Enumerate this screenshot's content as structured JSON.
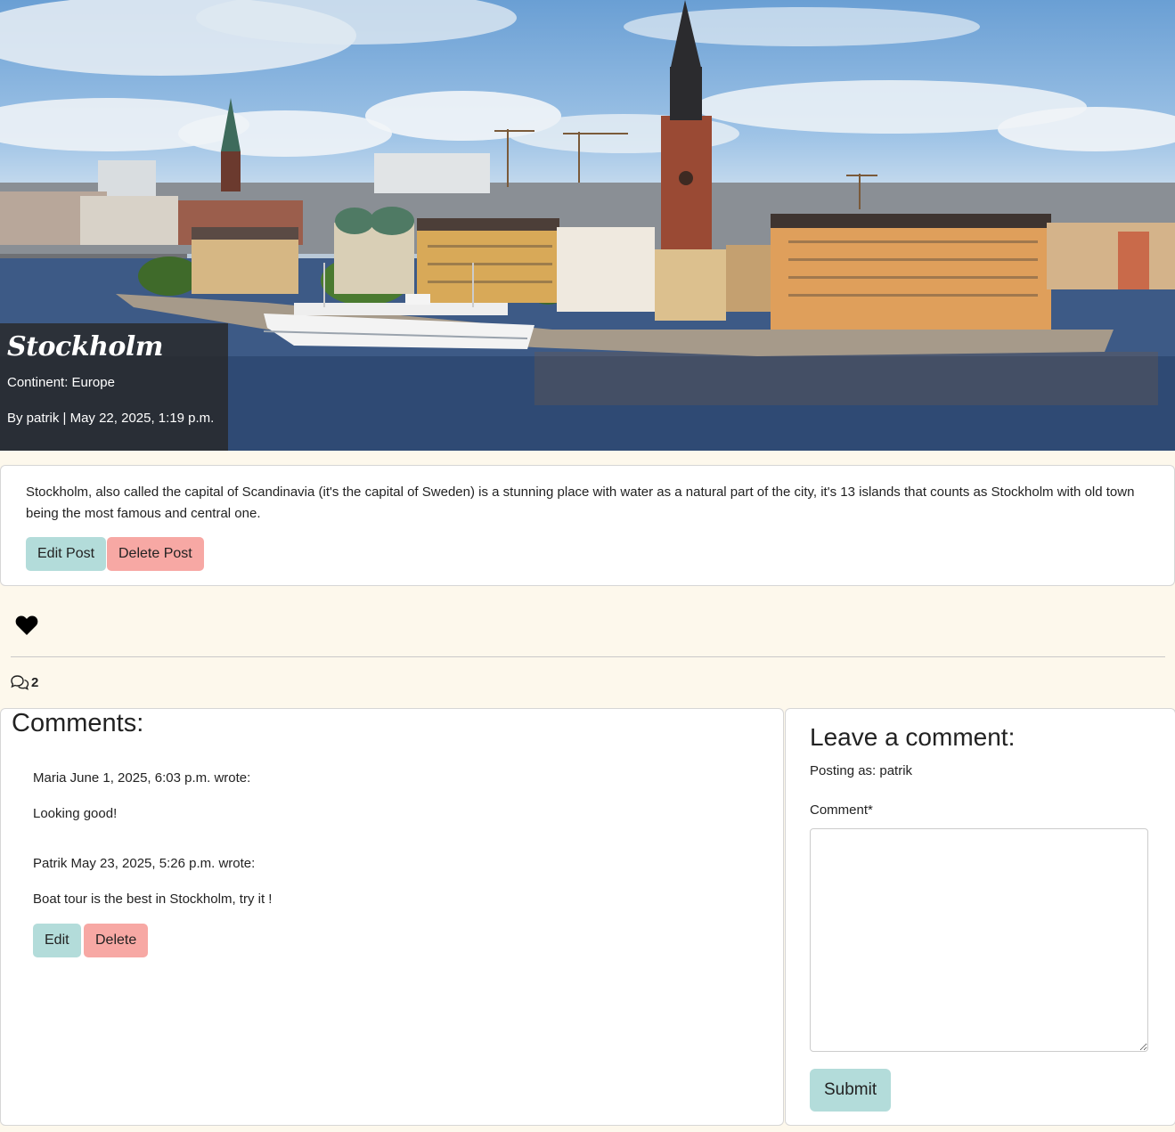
{
  "post": {
    "title": "Stockholm",
    "continent": "Continent: Europe",
    "byline": "By patrik | May 22, 2025, 1:19 p.m.",
    "body": "Stockholm, also called the capital of Scandinavia (it's the capital of Sweden) is a stunning place with water as a natural part of the city, it's 13 islands that counts as Stockholm with old town being the most famous and central one.",
    "edit_label": "Edit Post",
    "delete_label": "Delete Post"
  },
  "likes": {
    "icon": "heart-icon"
  },
  "comments_summary": {
    "icon": "comments-icon",
    "count": "2"
  },
  "comments": {
    "heading": "Comments:",
    "items": [
      {
        "meta": "Maria June 1, 2025, 6:03 p.m. wrote:",
        "text": "Looking good!"
      },
      {
        "meta": "Patrik May 23, 2025, 5:26 p.m. wrote:",
        "text": "Boat tour is the best in Stockholm, try it !"
      }
    ],
    "edit_label": "Edit",
    "delete_label": "Delete"
  },
  "form": {
    "heading": "Leave a comment:",
    "posting_as": "Posting as: patrik",
    "comment_label": "Comment*",
    "comment_value": "",
    "submit_label": "Submit"
  },
  "colors": {
    "page_bg": "#fdf8ec",
    "edit_button": "#b3dcda",
    "delete_button": "#f7a8a4"
  }
}
